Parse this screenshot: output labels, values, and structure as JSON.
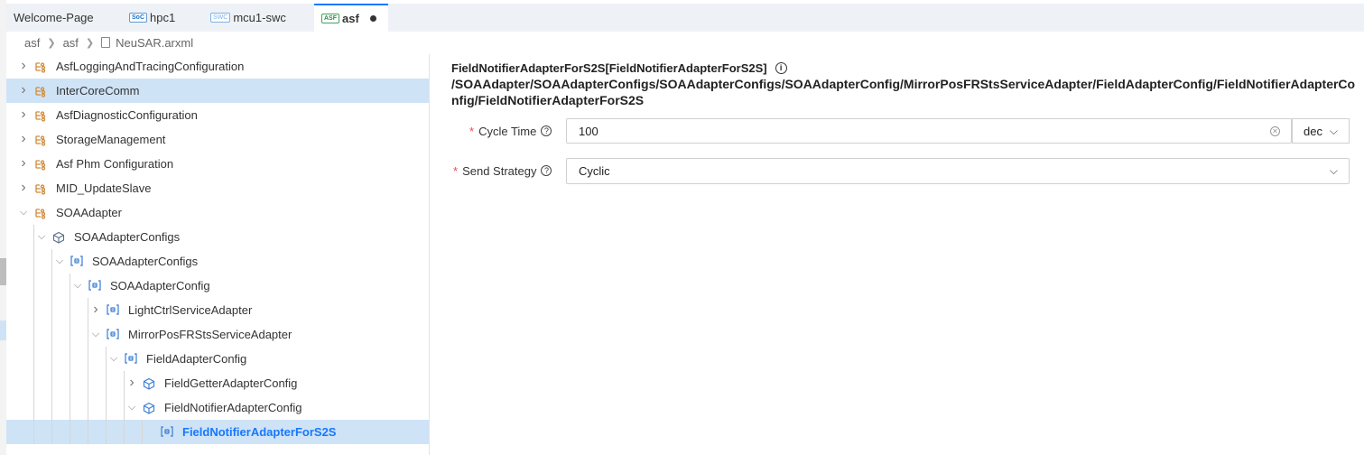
{
  "tabs": [
    {
      "label": "Welcome-Page",
      "badge": ""
    },
    {
      "label": "hpc1",
      "badge": "SoC"
    },
    {
      "label": "mcu1-swc",
      "badge": "SWC"
    },
    {
      "label": "asf",
      "badge": "ASF",
      "active": true,
      "modified": true
    }
  ],
  "breadcrumb": {
    "items": [
      "asf",
      "asf"
    ],
    "file": "NeuSAR.arxml"
  },
  "tree": {
    "items": [
      {
        "label": "AsfLoggingAndTracingConfiguration",
        "depth": 0,
        "state": "collapsed",
        "icon": "module-icon"
      },
      {
        "label": "InterCoreComm",
        "depth": 0,
        "state": "collapsed",
        "icon": "module-icon",
        "highlighted": true
      },
      {
        "label": "AsfDiagnosticConfiguration",
        "depth": 0,
        "state": "collapsed",
        "icon": "module-icon"
      },
      {
        "label": "StorageManagement",
        "depth": 0,
        "state": "collapsed",
        "icon": "module-icon"
      },
      {
        "label": "Asf Phm Configuration",
        "depth": 0,
        "state": "collapsed",
        "icon": "module-icon"
      },
      {
        "label": "MID_UpdateSlave",
        "depth": 0,
        "state": "collapsed",
        "icon": "module-icon"
      },
      {
        "label": "SOAAdapter",
        "depth": 0,
        "state": "expanded",
        "icon": "module-icon"
      },
      {
        "label": "SOAAdapterConfigs",
        "depth": 1,
        "state": "expanded",
        "icon": "cube-icon"
      },
      {
        "label": "SOAAdapterConfigs",
        "depth": 2,
        "state": "expanded",
        "icon": "container-icon"
      },
      {
        "label": "SOAAdapterConfig",
        "depth": 3,
        "state": "expanded",
        "icon": "container-icon"
      },
      {
        "label": "LightCtrlServiceAdapter",
        "depth": 4,
        "state": "collapsed",
        "icon": "container-icon"
      },
      {
        "label": "MirrorPosFRStsServiceAdapter",
        "depth": 4,
        "state": "expanded",
        "icon": "container-icon"
      },
      {
        "label": "FieldAdapterConfig",
        "depth": 5,
        "state": "expanded",
        "icon": "container-icon"
      },
      {
        "label": "FieldGetterAdapterConfig",
        "depth": 6,
        "state": "collapsed",
        "icon": "cube-icon"
      },
      {
        "label": "FieldNotifierAdapterConfig",
        "depth": 6,
        "state": "expanded",
        "icon": "cube-icon"
      },
      {
        "label": "FieldNotifierAdapterForS2S",
        "depth": 7,
        "state": "leaf",
        "icon": "container-icon",
        "selected": true
      }
    ]
  },
  "panel": {
    "title": "FieldNotifierAdapterForS2S[FieldNotifierAdapterForS2S]",
    "path": "/SOAAdapter/SOAAdapterConfigs/SOAAdapterConfigs/SOAAdapterConfig/MirrorPosFRStsServiceAdapter/FieldAdapterConfig/FieldNotifierAdapterConfig/FieldNotifierAdapterForS2S",
    "cycle_time": {
      "label": "Cycle Time",
      "value": "100",
      "unit": "dec"
    },
    "send_strategy": {
      "label": "Send Strategy",
      "value": "Cyclic"
    }
  },
  "colors": {
    "accent": "#1677ff",
    "selection": "#cfe3f6",
    "module_icon": "#d08b3a",
    "container_icon": "#3a7bd5",
    "required": "#e34d59"
  }
}
